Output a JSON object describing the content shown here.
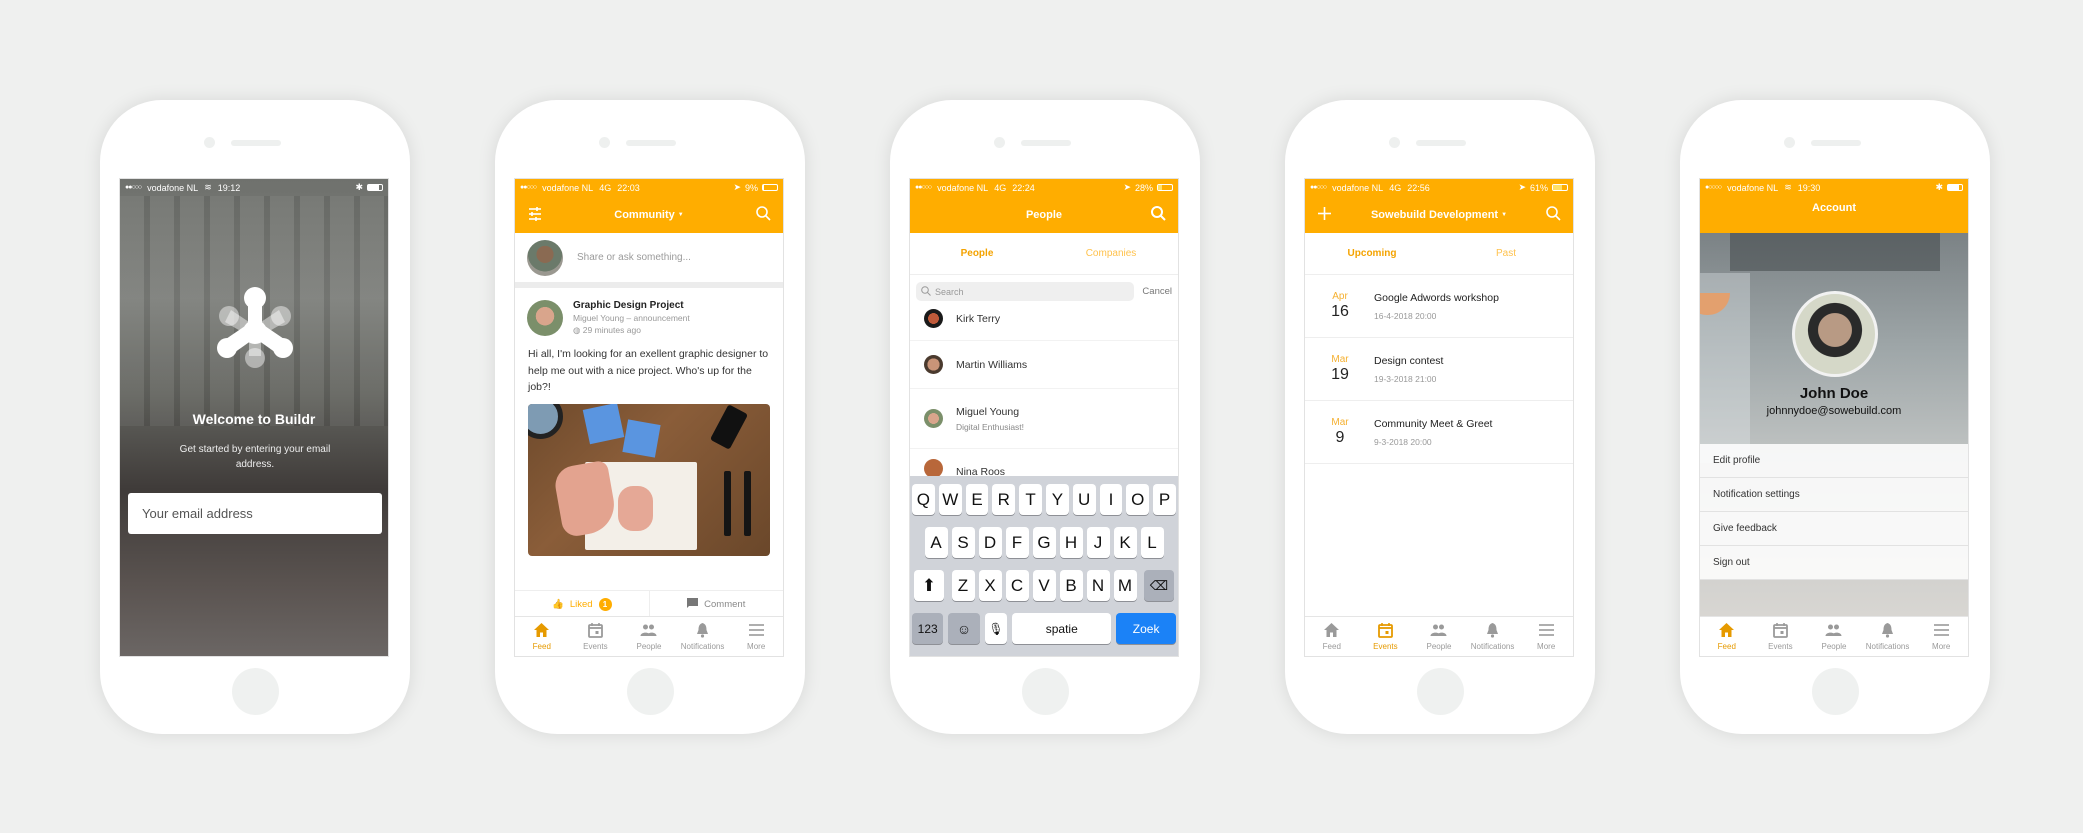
{
  "colors": {
    "accent": "#ffad00",
    "background": "#eff0ef",
    "keyboard_go": "#1b82f7"
  },
  "screens": {
    "welcome": {
      "status": {
        "carrier": "vodafone NL",
        "network": "wifi",
        "time": "19:12"
      },
      "logo_icon": "buildr-asterisk-logo",
      "title": "Welcome to Buildr",
      "subtitle": "Get started by entering your email address.",
      "email_placeholder": "Your email address"
    },
    "feed": {
      "status": {
        "carrier": "vodafone NL",
        "network": "4G",
        "time": "22:03",
        "battery": "9%"
      },
      "nav_title": "Community",
      "composer_placeholder": "Share or ask something...",
      "post": {
        "title": "Graphic Design Project",
        "meta": "Miguel Young – announcement",
        "time": "29 minutes ago",
        "body": "Hi all, I'm looking for an exellent graphic designer to help me out with a nice project. Who's up for the job?!",
        "liked_label": "Liked",
        "like_count": "1",
        "comment_label": "Comment"
      },
      "active_tab": "Feed"
    },
    "people": {
      "status": {
        "carrier": "vodafone NL",
        "network": "4G",
        "time": "22:24",
        "battery": "28%"
      },
      "nav_title": "People",
      "segments": [
        "People",
        "Companies"
      ],
      "search_placeholder": "Search",
      "cancel_label": "Cancel",
      "list": [
        {
          "name": "Kirk Terry",
          "sub": ""
        },
        {
          "name": "Martin Williams",
          "sub": ""
        },
        {
          "name": "Miguel Young",
          "sub": "Digital Enthusiast!"
        },
        {
          "name": "Nina Roos",
          "sub": ""
        }
      ],
      "keyboard": {
        "row1": [
          "Q",
          "W",
          "E",
          "R",
          "T",
          "Y",
          "U",
          "I",
          "O",
          "P"
        ],
        "row2": [
          "A",
          "S",
          "D",
          "F",
          "G",
          "H",
          "J",
          "K",
          "L"
        ],
        "row3": [
          "Z",
          "X",
          "C",
          "V",
          "B",
          "N",
          "M"
        ],
        "num_label": "123",
        "space_label": "spatie",
        "go_label": "Zoek"
      }
    },
    "events": {
      "status": {
        "carrier": "vodafone NL",
        "network": "4G",
        "time": "22:56",
        "battery": "61%"
      },
      "nav_title": "Sowebuild Development",
      "segments": [
        "Upcoming",
        "Past"
      ],
      "list": [
        {
          "month": "Apr",
          "day": "16",
          "name": "Google Adwords workshop",
          "when": "16-4-2018 20:00"
        },
        {
          "month": "Mar",
          "day": "19",
          "name": "Design contest",
          "when": "19-3-2018 21:00"
        },
        {
          "month": "Mar",
          "day": "9",
          "name": "Community Meet & Greet",
          "when": "9-3-2018 20:00"
        }
      ],
      "active_tab": "Events"
    },
    "account": {
      "status": {
        "carrier": "vodafone NL",
        "network": "wifi",
        "time": "19:30"
      },
      "nav_title": "Account",
      "name": "John Doe",
      "email": "johnnydoe@sowebuild.com",
      "menu": [
        "Edit profile",
        "Notification settings",
        "Give feedback",
        "Sign out"
      ],
      "active_tab": "Feed"
    }
  },
  "tabs": [
    "Feed",
    "Events",
    "People",
    "Notifications",
    "More"
  ]
}
